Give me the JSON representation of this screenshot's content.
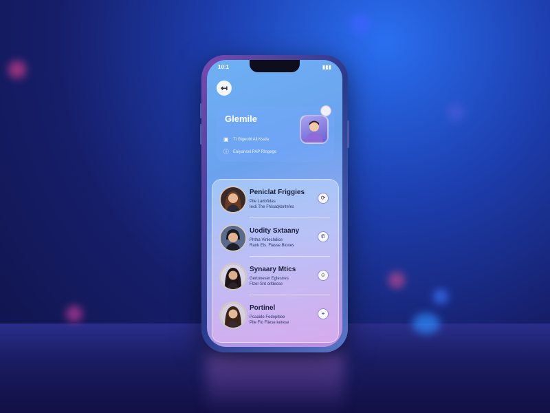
{
  "status_bar": {
    "time": "10:1",
    "icons": "▮▮▮"
  },
  "header": {
    "back_icon": "back-arrow-icon"
  },
  "profile": {
    "name": "Glemile",
    "lines": [
      {
        "icon": "card-icon",
        "text": "Tl Gigeobl All Ksala"
      },
      {
        "icon": "info-icon",
        "text": "Eaiyanoxl PAP Rlngege"
      }
    ],
    "avatar_icon": "person-avatar-icon"
  },
  "contacts": [
    {
      "name": "Peniclat Friggies",
      "line1": "Pile Ladofidas",
      "line2": "Iecli The Fhlsaqkbritefes",
      "action_icon": "chat-icon"
    },
    {
      "name": "Uodity Sxtaany",
      "line1": "Phtha Vinlechdice",
      "line2": "Rank Els. Flasse Biones",
      "action_icon": "phone-icon"
    },
    {
      "name": "Synaary Mtics",
      "line1": "Gertoneser Eglestres",
      "line2": "Flzer Snt oifdecse",
      "action_icon": "person-icon"
    },
    {
      "name": "Portinel",
      "line1": "Pcaaide Fedepitiee",
      "line2": "Pile Flo Fiiese kerese",
      "action_icon": "location-icon"
    }
  ],
  "colors": {
    "accent": "#6aa2ee",
    "panel_gradient_top": "#c8e1ff",
    "panel_gradient_bottom": "#e6bef5"
  }
}
